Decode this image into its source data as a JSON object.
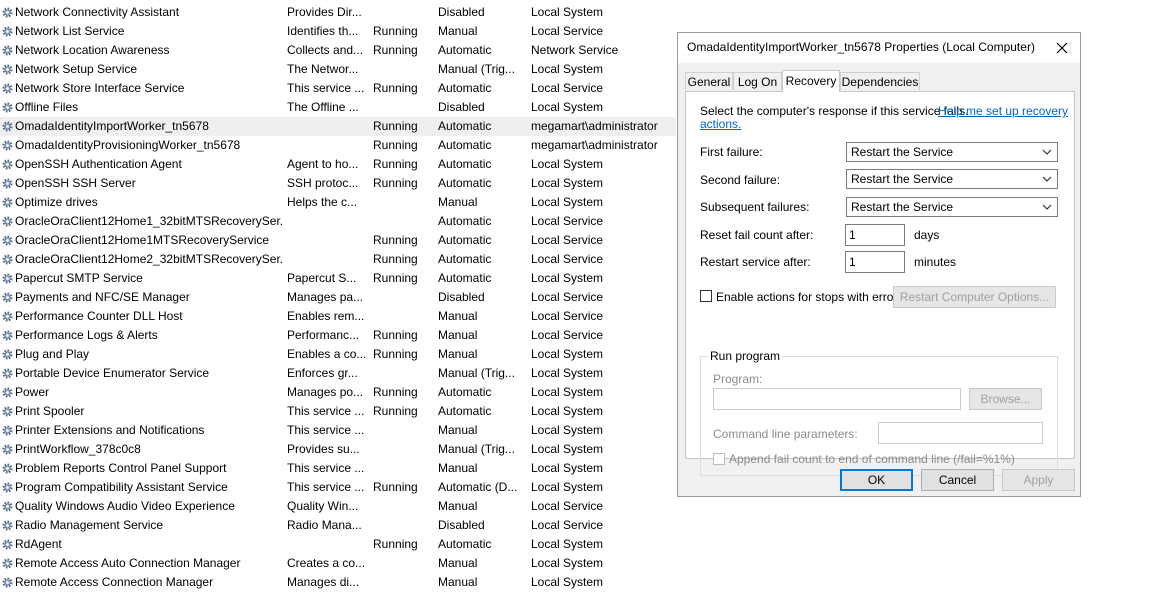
{
  "services": [
    {
      "name": "Network Connectivity Assistant",
      "description": "Provides Dir...",
      "status": "",
      "startup": "Disabled",
      "logon": "Local System"
    },
    {
      "name": "Network List Service",
      "description": "Identifies th...",
      "status": "Running",
      "startup": "Manual",
      "logon": "Local Service"
    },
    {
      "name": "Network Location Awareness",
      "description": "Collects and...",
      "status": "Running",
      "startup": "Automatic",
      "logon": "Network Service"
    },
    {
      "name": "Network Setup Service",
      "description": "The Networ...",
      "status": "",
      "startup": "Manual (Trig...",
      "logon": "Local System"
    },
    {
      "name": "Network Store Interface Service",
      "description": "This service ...",
      "status": "Running",
      "startup": "Automatic",
      "logon": "Local Service"
    },
    {
      "name": "Offline Files",
      "description": "The Offline ...",
      "status": "",
      "startup": "Disabled",
      "logon": "Local System"
    },
    {
      "name": "OmadaIdentityImportWorker_tn5678",
      "description": "",
      "status": "Running",
      "startup": "Automatic",
      "logon": "megamart\\administrator"
    },
    {
      "name": "OmadaIdentityProvisioningWorker_tn5678",
      "description": "",
      "status": "Running",
      "startup": "Automatic",
      "logon": "megamart\\administrator"
    },
    {
      "name": "OpenSSH Authentication Agent",
      "description": "Agent to ho...",
      "status": "Running",
      "startup": "Automatic",
      "logon": "Local System"
    },
    {
      "name": "OpenSSH SSH Server",
      "description": "SSH protoc...",
      "status": "Running",
      "startup": "Automatic",
      "logon": "Local System"
    },
    {
      "name": "Optimize drives",
      "description": "Helps the c...",
      "status": "",
      "startup": "Manual",
      "logon": "Local System"
    },
    {
      "name": "OracleOraClient12Home1_32bitMTSRecoverySer...",
      "description": "",
      "status": "",
      "startup": "Automatic",
      "logon": "Local Service"
    },
    {
      "name": "OracleOraClient12Home1MTSRecoveryService",
      "description": "",
      "status": "Running",
      "startup": "Automatic",
      "logon": "Local Service"
    },
    {
      "name": "OracleOraClient12Home2_32bitMTSRecoverySer...",
      "description": "",
      "status": "Running",
      "startup": "Automatic",
      "logon": "Local Service"
    },
    {
      "name": "Papercut SMTP Service",
      "description": "Papercut S...",
      "status": "Running",
      "startup": "Automatic",
      "logon": "Local System"
    },
    {
      "name": "Payments and NFC/SE Manager",
      "description": "Manages pa...",
      "status": "",
      "startup": "Disabled",
      "logon": "Local Service"
    },
    {
      "name": "Performance Counter DLL Host",
      "description": "Enables rem...",
      "status": "",
      "startup": "Manual",
      "logon": "Local Service"
    },
    {
      "name": "Performance Logs & Alerts",
      "description": "Performanc...",
      "status": "Running",
      "startup": "Manual",
      "logon": "Local Service"
    },
    {
      "name": "Plug and Play",
      "description": "Enables a co...",
      "status": "Running",
      "startup": "Manual",
      "logon": "Local System"
    },
    {
      "name": "Portable Device Enumerator Service",
      "description": "Enforces gr...",
      "status": "",
      "startup": "Manual (Trig...",
      "logon": "Local System"
    },
    {
      "name": "Power",
      "description": "Manages po...",
      "status": "Running",
      "startup": "Automatic",
      "logon": "Local System"
    },
    {
      "name": "Print Spooler",
      "description": "This service ...",
      "status": "Running",
      "startup": "Automatic",
      "logon": "Local System"
    },
    {
      "name": "Printer Extensions and Notifications",
      "description": "This service ...",
      "status": "",
      "startup": "Manual",
      "logon": "Local System"
    },
    {
      "name": "PrintWorkflow_378c0c8",
      "description": "Provides su...",
      "status": "",
      "startup": "Manual (Trig...",
      "logon": "Local System"
    },
    {
      "name": "Problem Reports Control Panel Support",
      "description": "This service ...",
      "status": "",
      "startup": "Manual",
      "logon": "Local System"
    },
    {
      "name": "Program Compatibility Assistant Service",
      "description": "This service ...",
      "status": "Running",
      "startup": "Automatic (D...",
      "logon": "Local System"
    },
    {
      "name": "Quality Windows Audio Video Experience",
      "description": "Quality Win...",
      "status": "",
      "startup": "Manual",
      "logon": "Local Service"
    },
    {
      "name": "Radio Management Service",
      "description": "Radio Mana...",
      "status": "",
      "startup": "Disabled",
      "logon": "Local Service"
    },
    {
      "name": "RdAgent",
      "description": "",
      "status": "Running",
      "startup": "Automatic",
      "logon": "Local System"
    },
    {
      "name": "Remote Access Auto Connection Manager",
      "description": "Creates a co...",
      "status": "",
      "startup": "Manual",
      "logon": "Local System"
    },
    {
      "name": "Remote Access Connection Manager",
      "description": "Manages di...",
      "status": "",
      "startup": "Manual",
      "logon": "Local System"
    }
  ],
  "selected_index": 6,
  "dialog": {
    "title": "OmadaIdentityImportWorker_tn5678 Properties (Local Computer)",
    "tabs": [
      "General",
      "Log On",
      "Recovery",
      "Dependencies"
    ],
    "active_tab": "Recovery",
    "intro_text": "Select the computer's response if this service fails.",
    "help_link_a": "Help me set up recovery",
    "help_link_b": "actions.",
    "first_failure_label": "First failure:",
    "first_failure_value": "Restart the Service",
    "second_failure_label": "Second failure:",
    "second_failure_value": "Restart the Service",
    "subsequent_failures_label": "Subsequent failures:",
    "subsequent_failures_value": "Restart the Service",
    "reset_fail_label": "Reset fail count after:",
    "reset_fail_value": "1",
    "reset_fail_unit": "days",
    "restart_service_label": "Restart service after:",
    "restart_service_value": "1",
    "restart_service_unit": "minutes",
    "enable_actions_label": "Enable actions for stops with errors.",
    "restart_computer_options": "Restart Computer Options...",
    "run_program_title": "Run program",
    "program_label": "Program:",
    "browse_label": "Browse...",
    "cmdline_label": "Command line parameters:",
    "append_fail_label": "Append fail count to end of command line (/fail=%1%)",
    "ok_label": "OK",
    "cancel_label": "Cancel",
    "apply_label": "Apply"
  },
  "colors": {
    "selected_row": "#efefef",
    "dialog_bg": "#f0f0f0",
    "link": "#0066cc",
    "primary_border": "#0078d7"
  }
}
